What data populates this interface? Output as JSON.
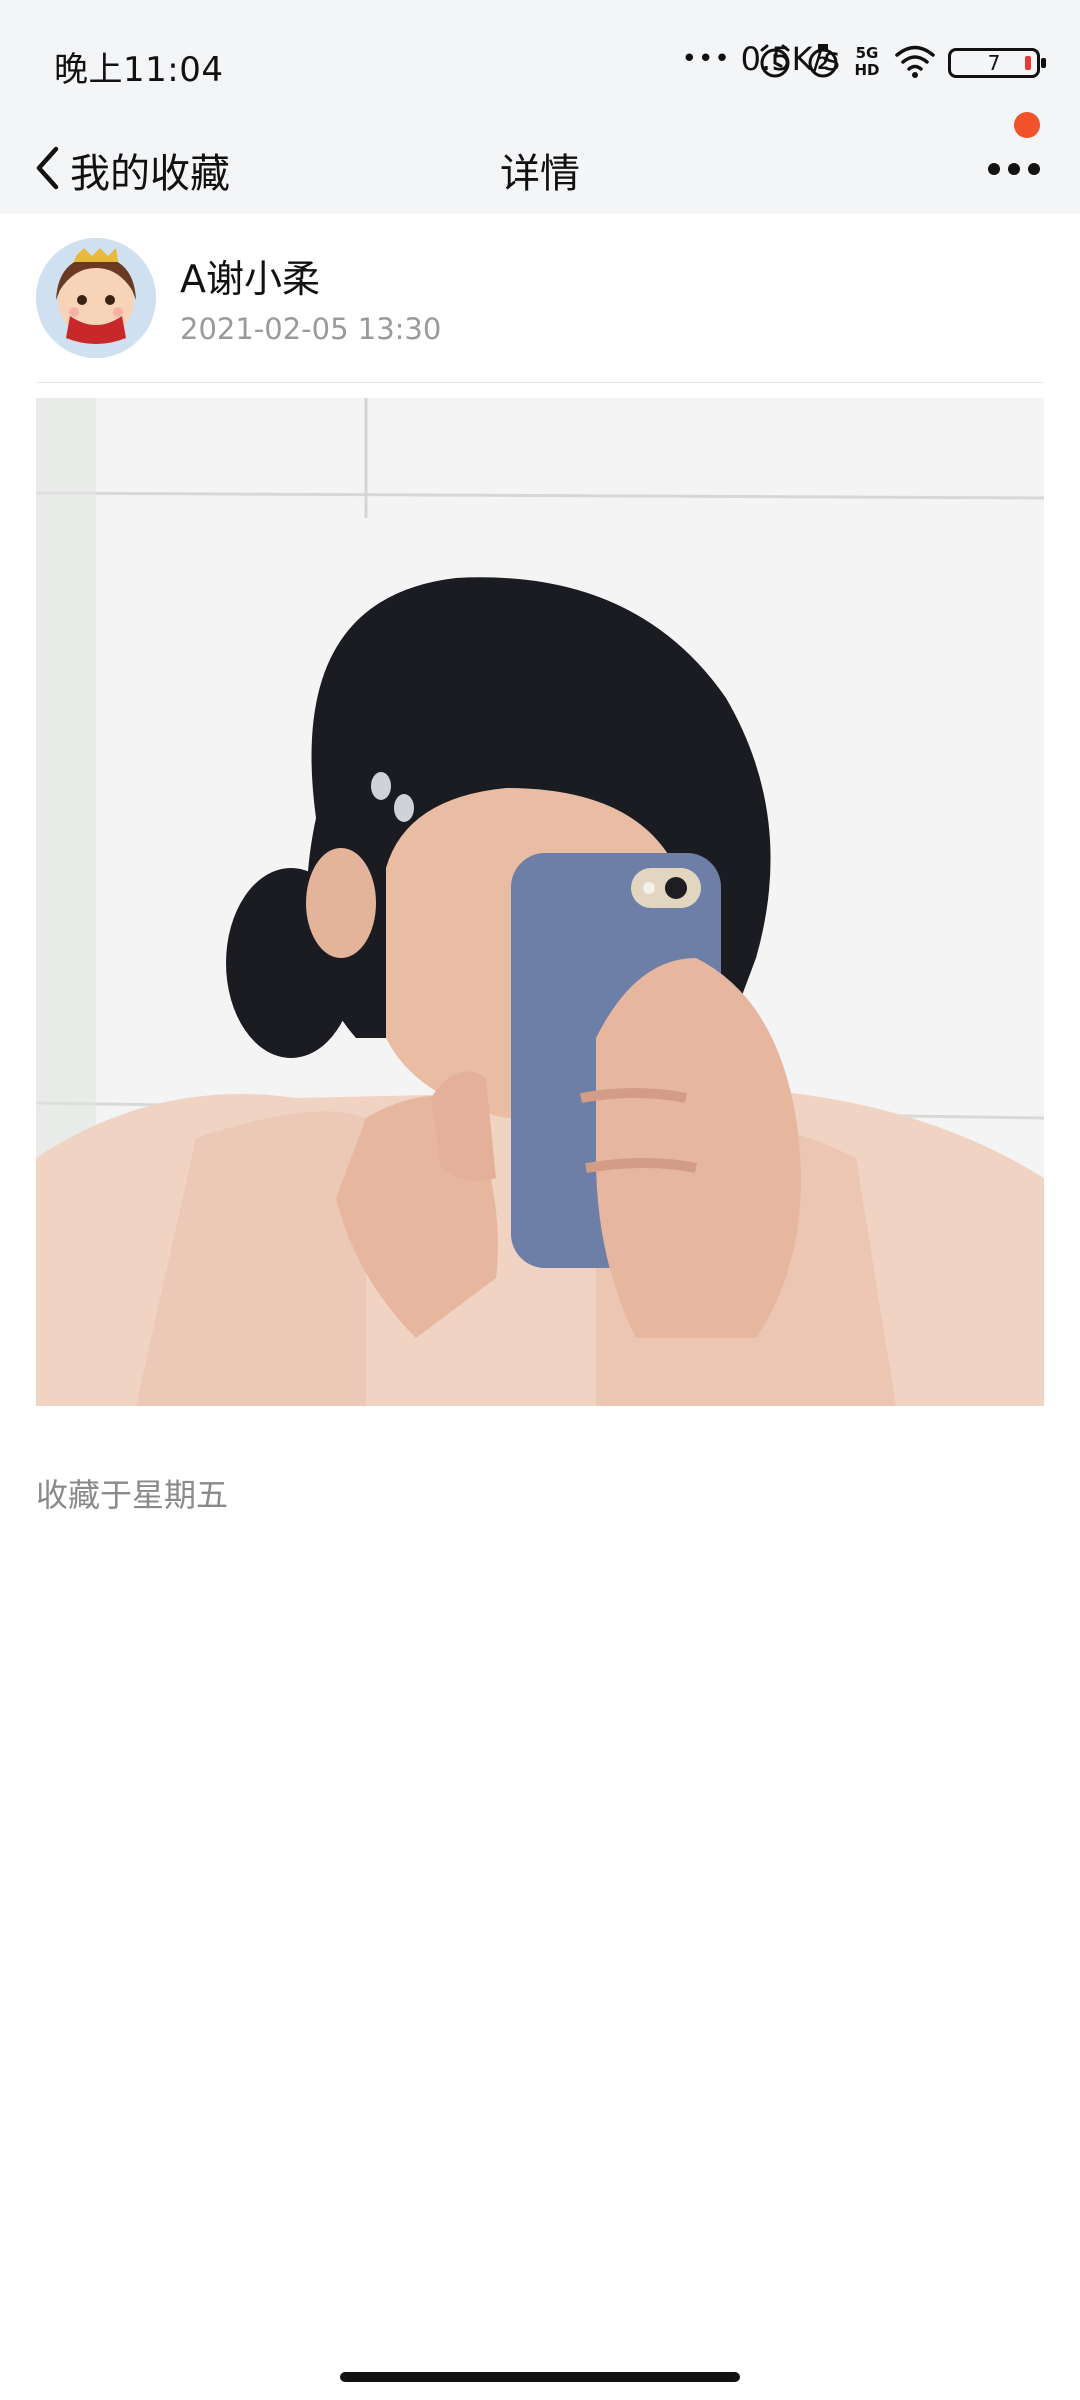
{
  "status_bar": {
    "time": "晚上11:04",
    "network_speed": "0.5K/s",
    "battery_level": "7",
    "icons": [
      "more-dots-icon",
      "alarm-icon",
      "sim2-icon",
      "5g-hd-icon",
      "wifi-icon",
      "battery-icon"
    ]
  },
  "nav": {
    "back_label": "我的收藏",
    "title": "详情",
    "has_notification": true
  },
  "post": {
    "author": "A谢小柔",
    "timestamp": "2021-02-05 13:30",
    "image_alt": "mirror-selfie-photo"
  },
  "saved_note": "收藏于星期五",
  "colors": {
    "status_bg": "#f4f5f7",
    "accent_dot": "#f1522b",
    "muted_text": "#9a9a9a"
  }
}
